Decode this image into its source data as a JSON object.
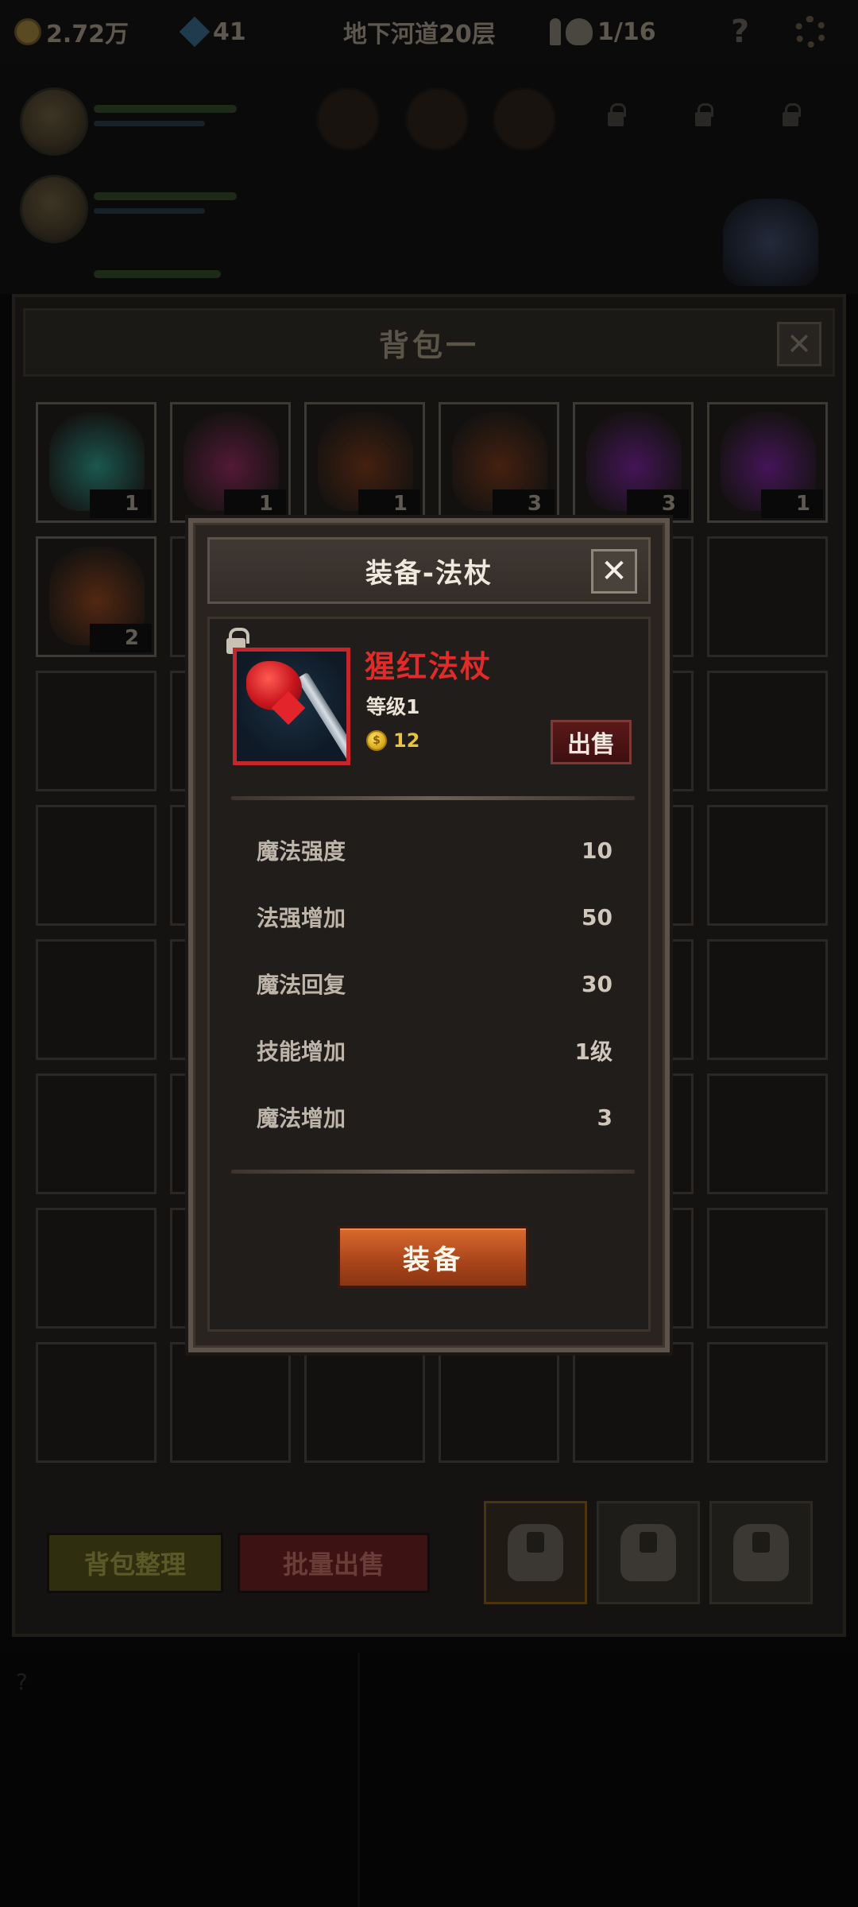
{
  "status_bar": {
    "gold": "2.72万",
    "gems": "41",
    "location": "地下河道20层",
    "kills": "1/16"
  },
  "backpack": {
    "title": "背包一",
    "items": [
      {
        "qty": "1",
        "color": "#1c5f57"
      },
      {
        "qty": "1",
        "color": "#5a1a3a"
      },
      {
        "qty": "1",
        "color": "#4a2210"
      },
      {
        "qty": "3",
        "color": "#4a2210"
      },
      {
        "qty": "3",
        "color": "#4a1560"
      },
      {
        "qty": "1",
        "color": "#4a1560"
      },
      {
        "qty": "2",
        "color": "#5a2a12"
      }
    ],
    "sort_button": "背包整理",
    "bulk_sell_button": "批量出售"
  },
  "modal": {
    "title": "装备-法杖",
    "item_name": "猩红法杖",
    "level": "等级1",
    "price": "12",
    "sell_button": "出售",
    "stats": [
      {
        "label": "魔法强度",
        "value": "10"
      },
      {
        "label": "法强增加",
        "value": "50"
      },
      {
        "label": "魔法回复",
        "value": "30"
      },
      {
        "label": "技能增加",
        "value": "1级"
      },
      {
        "label": "魔法增加",
        "value": "3"
      }
    ],
    "equip_button": "装备"
  },
  "colors": {
    "accent_red": "#e12a2a",
    "equip_orange": "#c55a24",
    "rarity_border": "#c4262b"
  }
}
